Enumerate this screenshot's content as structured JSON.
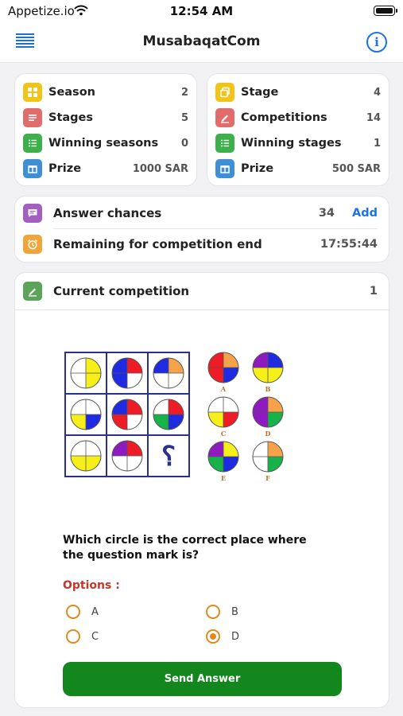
{
  "status_bar": {
    "carrier": "Appetize.io",
    "time": "12:54 AM"
  },
  "nav": {
    "title": "MusabaqatCom"
  },
  "season_card": {
    "rows": [
      {
        "label": "Season",
        "value": "2",
        "icon": "grid-icon",
        "color": "#f0c419"
      },
      {
        "label": "Stages",
        "value": "5",
        "icon": "lines-icon",
        "color": "#e06c6c"
      },
      {
        "label": "Winning seasons",
        "value": "0",
        "icon": "list-icon",
        "color": "#3db04b"
      },
      {
        "label": "Prize",
        "value": "1000 SAR",
        "icon": "gift-icon",
        "color": "#3f8fd6"
      }
    ]
  },
  "stage_card": {
    "rows": [
      {
        "label": "Stage",
        "value": "4",
        "icon": "copy-icon",
        "color": "#f0c419"
      },
      {
        "label": "Competitions",
        "value": "14",
        "icon": "pencil-icon",
        "color": "#e06c6c"
      },
      {
        "label": "Winning stages",
        "value": "1",
        "icon": "list-icon",
        "color": "#3db04b"
      },
      {
        "label": "Prize",
        "value": "500 SAR",
        "icon": "gift-icon",
        "color": "#3f8fd6"
      }
    ]
  },
  "answer_card": {
    "chances_label": "Answer chances",
    "chances_value": "34",
    "add_label": "Add",
    "remaining_label": "Remaining for competition end",
    "remaining_value": "17:55:44"
  },
  "competition_card": {
    "title": "Current competition",
    "number": "1",
    "puzzle": {
      "grid_mark": "؟",
      "choice_labels": [
        "A",
        "B",
        "C",
        "D",
        "E",
        "F"
      ]
    },
    "question": "Which circle is the correct place where the question mark is?",
    "options_label": "Options :",
    "options": [
      {
        "label": "A",
        "selected": false
      },
      {
        "label": "B",
        "selected": false
      },
      {
        "label": "C",
        "selected": false
      },
      {
        "label": "D",
        "selected": true
      }
    ],
    "send_label": "Send Answer"
  },
  "colors": {
    "accent_blue": "#1a73e8",
    "send_green": "#13871e",
    "radio_orange": "#e08a1e",
    "options_red": "#c0392b",
    "puzzle_blue": "#2b2f8f"
  }
}
